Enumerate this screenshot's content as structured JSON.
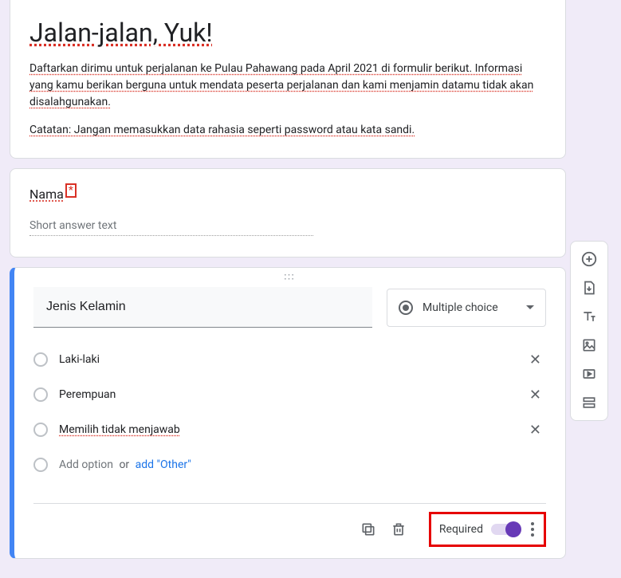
{
  "header": {
    "title": "Jalan-jalan, Yuk!",
    "desc1": "Daftarkan dirimu untuk perjalanan ke Pulau Pahawang pada April 2021 di formulir berikut. Informasi yang kamu berikan berguna untuk mendata peserta perjalanan dan kami menjamin datamu tidak akan disalahgunakan.",
    "desc2": "Catatan: Jangan memasukkan data rahasia seperti password atau kata sandi."
  },
  "q1": {
    "title": "Nama",
    "required_mark": "*",
    "placeholder": "Short answer text"
  },
  "q2": {
    "title": "Jenis Kelamin",
    "type_label": "Multiple choice",
    "options": {
      "0": "Laki-laki",
      "1": "Perempuan",
      "2": "Memilih tidak menjawab"
    },
    "add_option": "Add option",
    "or": "or",
    "add_other": "add \"Other\"",
    "required_label": "Required"
  }
}
